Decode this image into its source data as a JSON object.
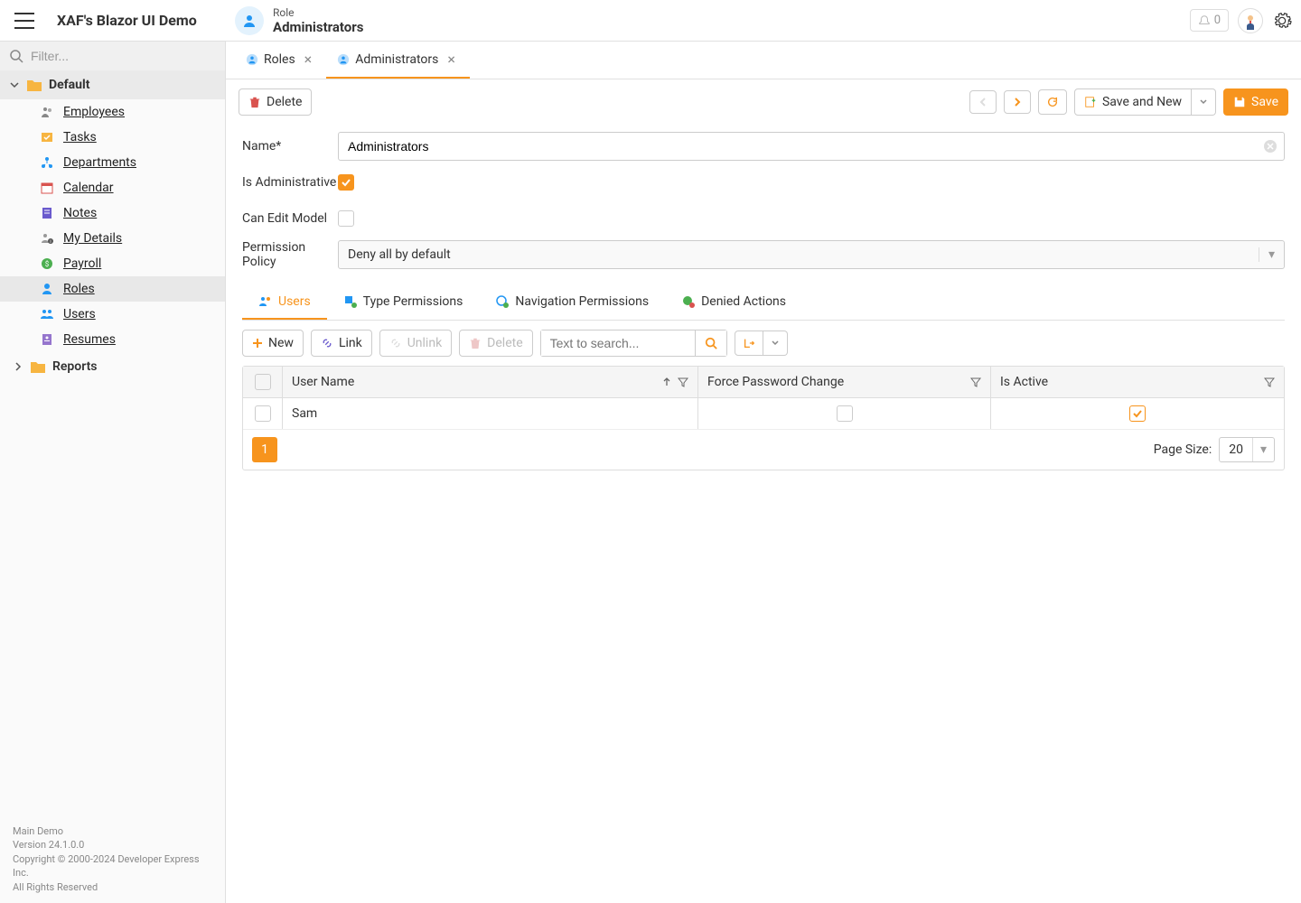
{
  "app": {
    "title": "XAF's Blazor UI Demo"
  },
  "header": {
    "entity": "Role",
    "name": "Administrators",
    "notif_count": "0"
  },
  "sidebar": {
    "filter_placeholder": "Filter...",
    "groups": {
      "default": "Default",
      "reports": "Reports"
    },
    "items": {
      "employees": "Employees",
      "tasks": "Tasks",
      "departments": "Departments",
      "calendar": "Calendar",
      "notes": "Notes",
      "mydetails": "My Details",
      "payroll": "Payroll",
      "roles": "Roles",
      "users": "Users",
      "resumes": "Resumes"
    },
    "footer": {
      "line1": "Main Demo",
      "line2": "Version 24.1.0.0",
      "line3": "Copyright © 2000-2024 Developer Express Inc.",
      "line4": "All Rights Reserved"
    }
  },
  "tabs": {
    "roles": "Roles",
    "administrators": "Administrators"
  },
  "toolbar": {
    "delete": "Delete",
    "save_and_new": "Save and New",
    "save": "Save"
  },
  "form": {
    "name_label": "Name*",
    "name_value": "Administrators",
    "is_admin_label": "Is Administrative",
    "can_edit_label": "Can Edit Model",
    "policy_label": "Permission Policy",
    "policy_value": "Deny all by default"
  },
  "subtabs": {
    "users": "Users",
    "type_perms": "Type Permissions",
    "nav_perms": "Navigation Permissions",
    "denied": "Denied Actions"
  },
  "grid_toolbar": {
    "new": "New",
    "link": "Link",
    "unlink": "Unlink",
    "delete": "Delete",
    "search_placeholder": "Text to search..."
  },
  "grid": {
    "columns": {
      "username": "User Name",
      "force_pw": "Force Password Change",
      "is_active": "Is Active"
    },
    "rows": [
      {
        "username": "Sam",
        "force_pw": false,
        "is_active": true
      }
    ],
    "page": "1",
    "page_size_label": "Page Size:",
    "page_size_value": "20"
  }
}
